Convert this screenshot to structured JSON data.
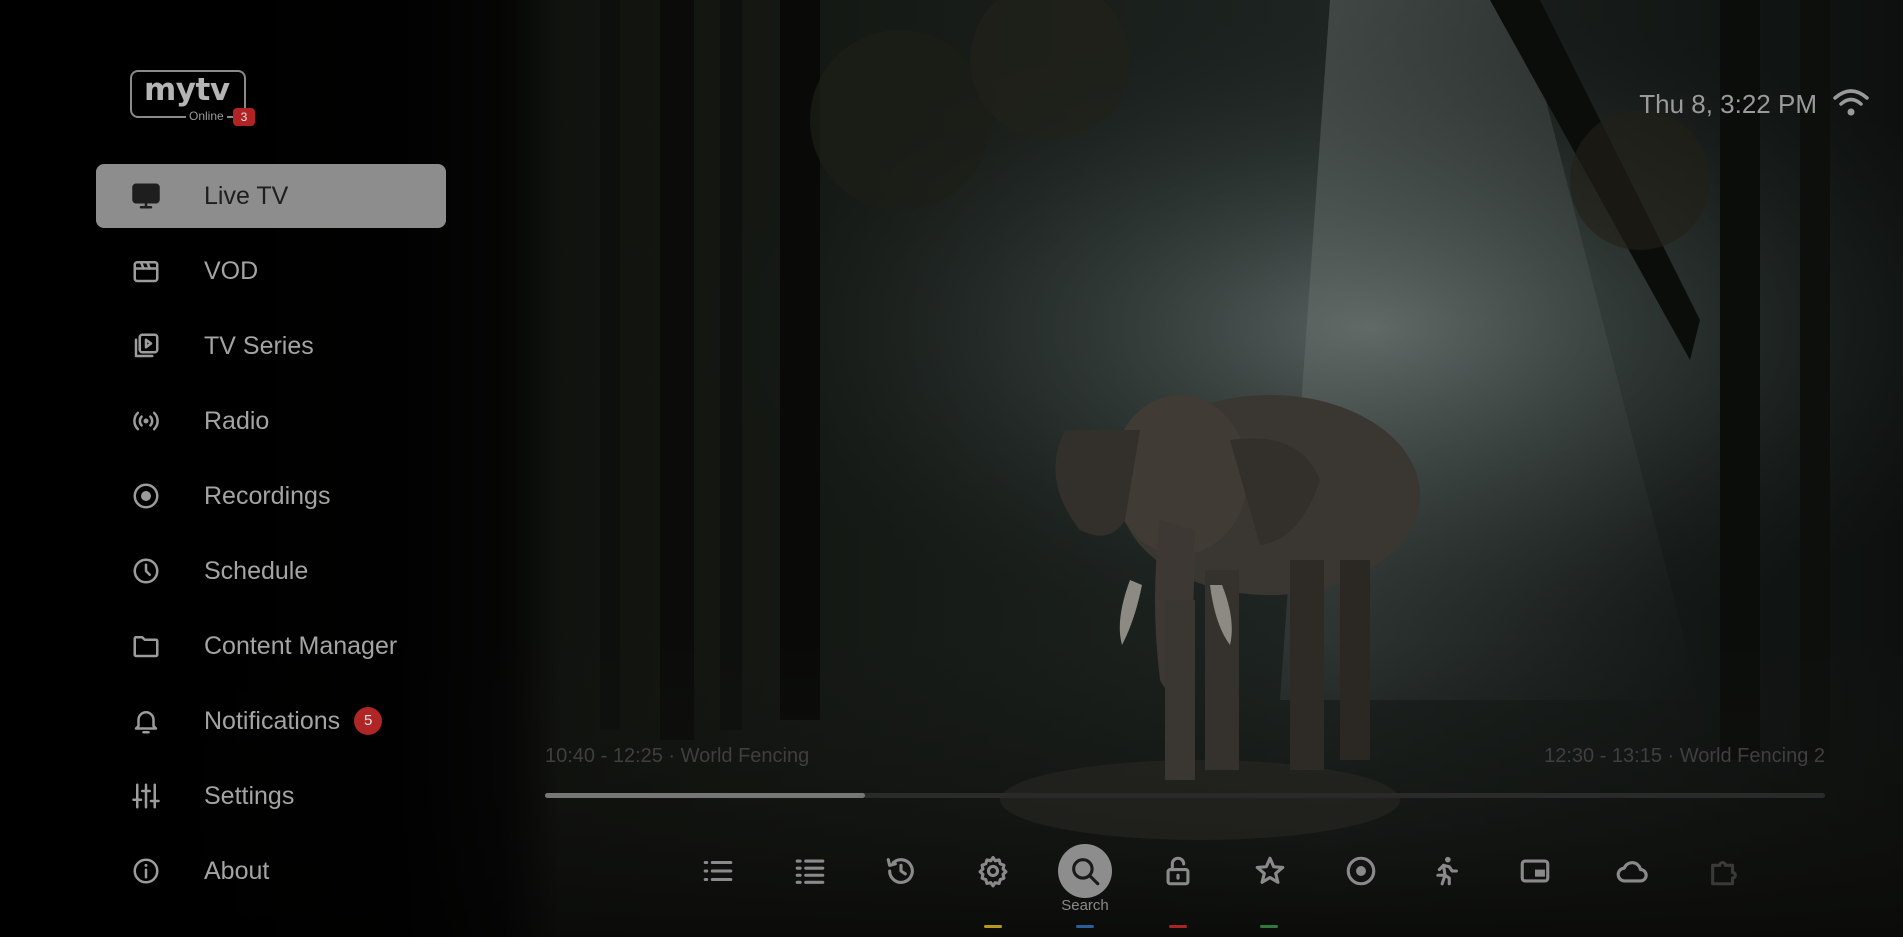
{
  "logo": {
    "brand": "mytv",
    "subtitle": "Online",
    "badge": "3"
  },
  "status": {
    "datetime": "Thu 8, 3:22 PM",
    "wifi_icon": "wifi-icon"
  },
  "sidebar": {
    "items": [
      {
        "label": "Live TV",
        "icon": "tv-icon",
        "active": true
      },
      {
        "label": "VOD",
        "icon": "clapperboard-icon"
      },
      {
        "label": "TV Series",
        "icon": "series-icon"
      },
      {
        "label": "Radio",
        "icon": "radio-icon"
      },
      {
        "label": "Recordings",
        "icon": "record-icon"
      },
      {
        "label": "Schedule",
        "icon": "clock-icon"
      },
      {
        "label": "Content Manager",
        "icon": "folder-icon"
      },
      {
        "label": "Notifications",
        "icon": "bell-icon",
        "badge": "5"
      },
      {
        "label": "Settings",
        "icon": "sliders-icon"
      },
      {
        "label": "About",
        "icon": "info-icon"
      }
    ]
  },
  "epg": {
    "current": "10:40 - 12:25 · World Fencing",
    "next": "12:30 - 13:15 · World Fencing 2",
    "progress": 0.25
  },
  "toolbar": {
    "active_label": "Search",
    "tools": [
      "list-icon",
      "list-alt-icon",
      "history-icon",
      "gear-icon",
      "search-icon",
      "lock-icon",
      "star-icon",
      "record-icon",
      "running-icon",
      "pip-icon",
      "cloud-icon",
      "puzzle-icon"
    ]
  },
  "colors": {
    "active_bg": "#8d8d8d",
    "badge_red": "#b02525",
    "key_yellow": "#b59a1c",
    "key_blue": "#2a5f9a",
    "key_red": "#a82525",
    "key_green": "#2f7a3a"
  }
}
